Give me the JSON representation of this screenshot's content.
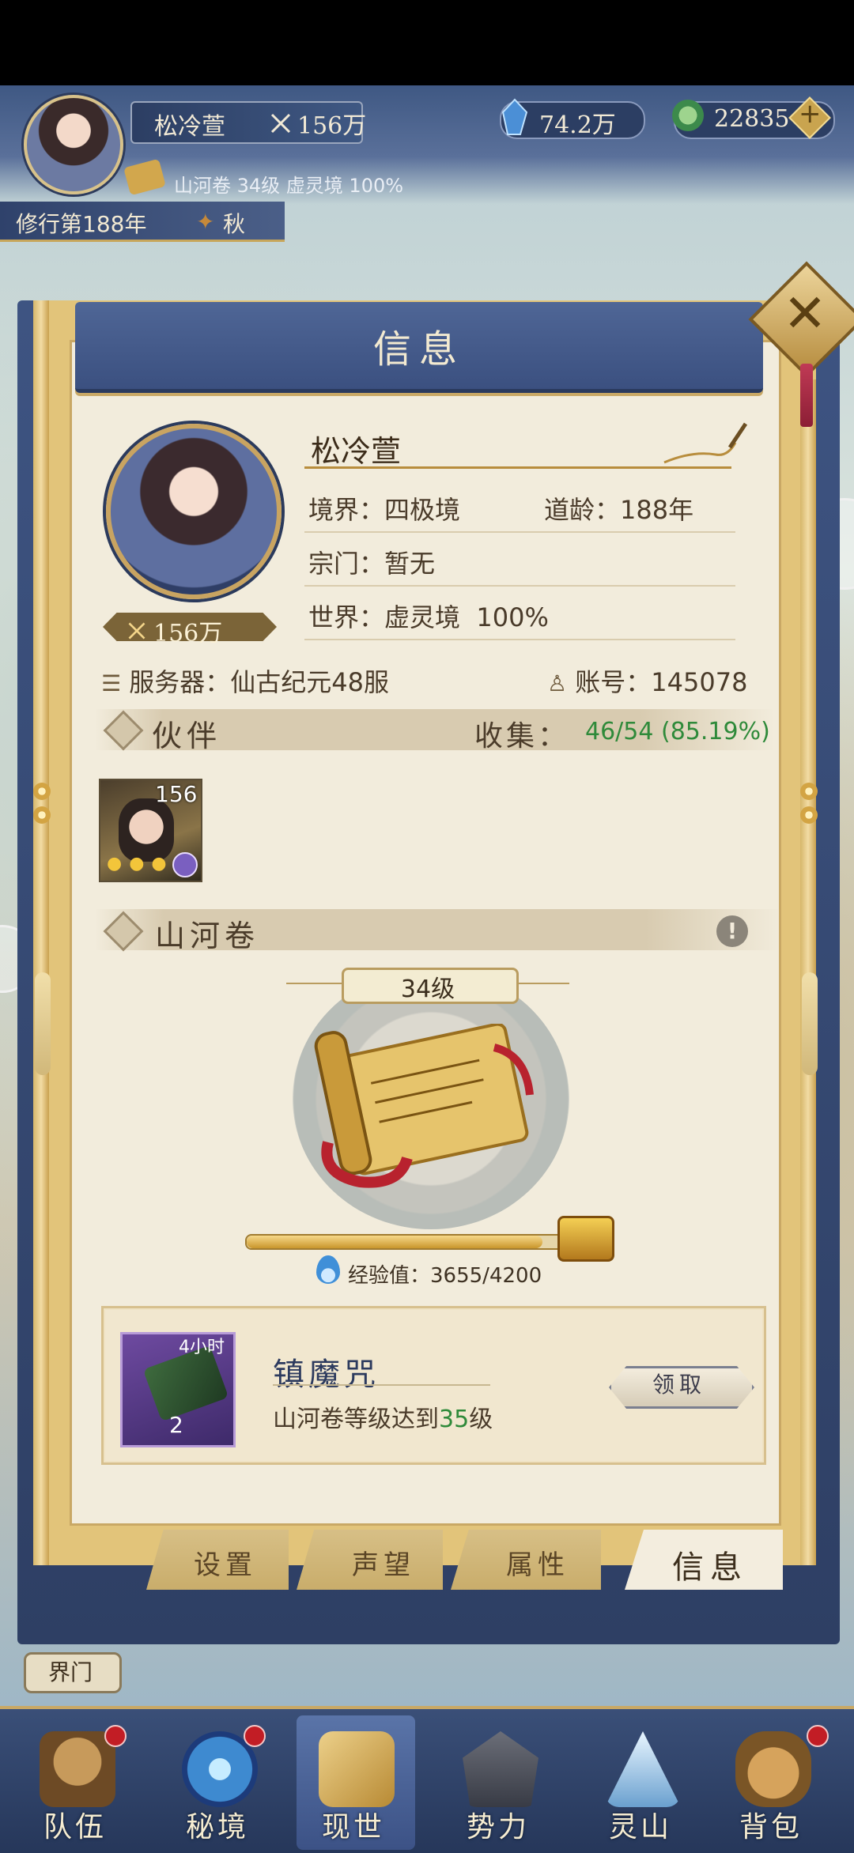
{
  "hud": {
    "player_name": "松冷萱",
    "power": "156万",
    "resource_spirit_stone": "74.2万",
    "resource_jade": "22835",
    "scroll_info": "山河卷 34级 虚灵境 100%",
    "year": "修行第188年",
    "season": "秋"
  },
  "modal": {
    "title": "信息",
    "close_icon": "close-x-icon",
    "profile": {
      "name": "松冷萱",
      "power": "156万",
      "realm_label": "境界：",
      "realm_value": "四极境",
      "age_label": "道龄：",
      "age_value": "188年",
      "sect_label": "宗门：",
      "sect_value": "暂无",
      "world_label": "世界：",
      "world_value": "虚灵境",
      "world_progress": "100%",
      "server_label": "服务器：",
      "server_value": "仙古纪元48服",
      "account_label": "账号：",
      "account_value": "145078"
    },
    "partners": {
      "title": "伙伴",
      "collect_label": "收集：",
      "collect_value": "46/54 (85.19%)",
      "items": [
        {
          "level": "156",
          "stars": 3
        }
      ]
    },
    "scroll": {
      "title": "山河卷",
      "info_icon": "!",
      "level": "34级",
      "exp_label": "经验值：",
      "exp_value": "3655/4200",
      "exp_current": 3655,
      "exp_max": 4200
    },
    "reward": {
      "time": "4小时",
      "count": "2",
      "name": "镇魔咒",
      "desc_prefix": "山河卷等级达到",
      "desc_level": "35",
      "desc_suffix": "级",
      "claim_label": "领取"
    },
    "tabs": [
      {
        "label": "设置"
      },
      {
        "label": "声望"
      },
      {
        "label": "属性"
      },
      {
        "label": "信息"
      }
    ]
  },
  "portal_label": "界门",
  "bottom_nav": [
    {
      "label": "队伍",
      "icon": "team-hat-icon",
      "badge": true
    },
    {
      "label": "秘境",
      "icon": "portal-swirl-icon",
      "badge": true
    },
    {
      "label": "现世",
      "icon": "world-scroll-icon",
      "badge": false
    },
    {
      "label": "势力",
      "icon": "faction-palace-icon",
      "badge": false
    },
    {
      "label": "灵山",
      "icon": "spirit-mountain-icon",
      "badge": false
    },
    {
      "label": "背包",
      "icon": "bag-icon",
      "badge": true
    }
  ],
  "colors": {
    "navy": "#3b5080",
    "gold": "#c9a865",
    "paper": "#f2ecdc",
    "green_text": "#2f8a3a"
  }
}
